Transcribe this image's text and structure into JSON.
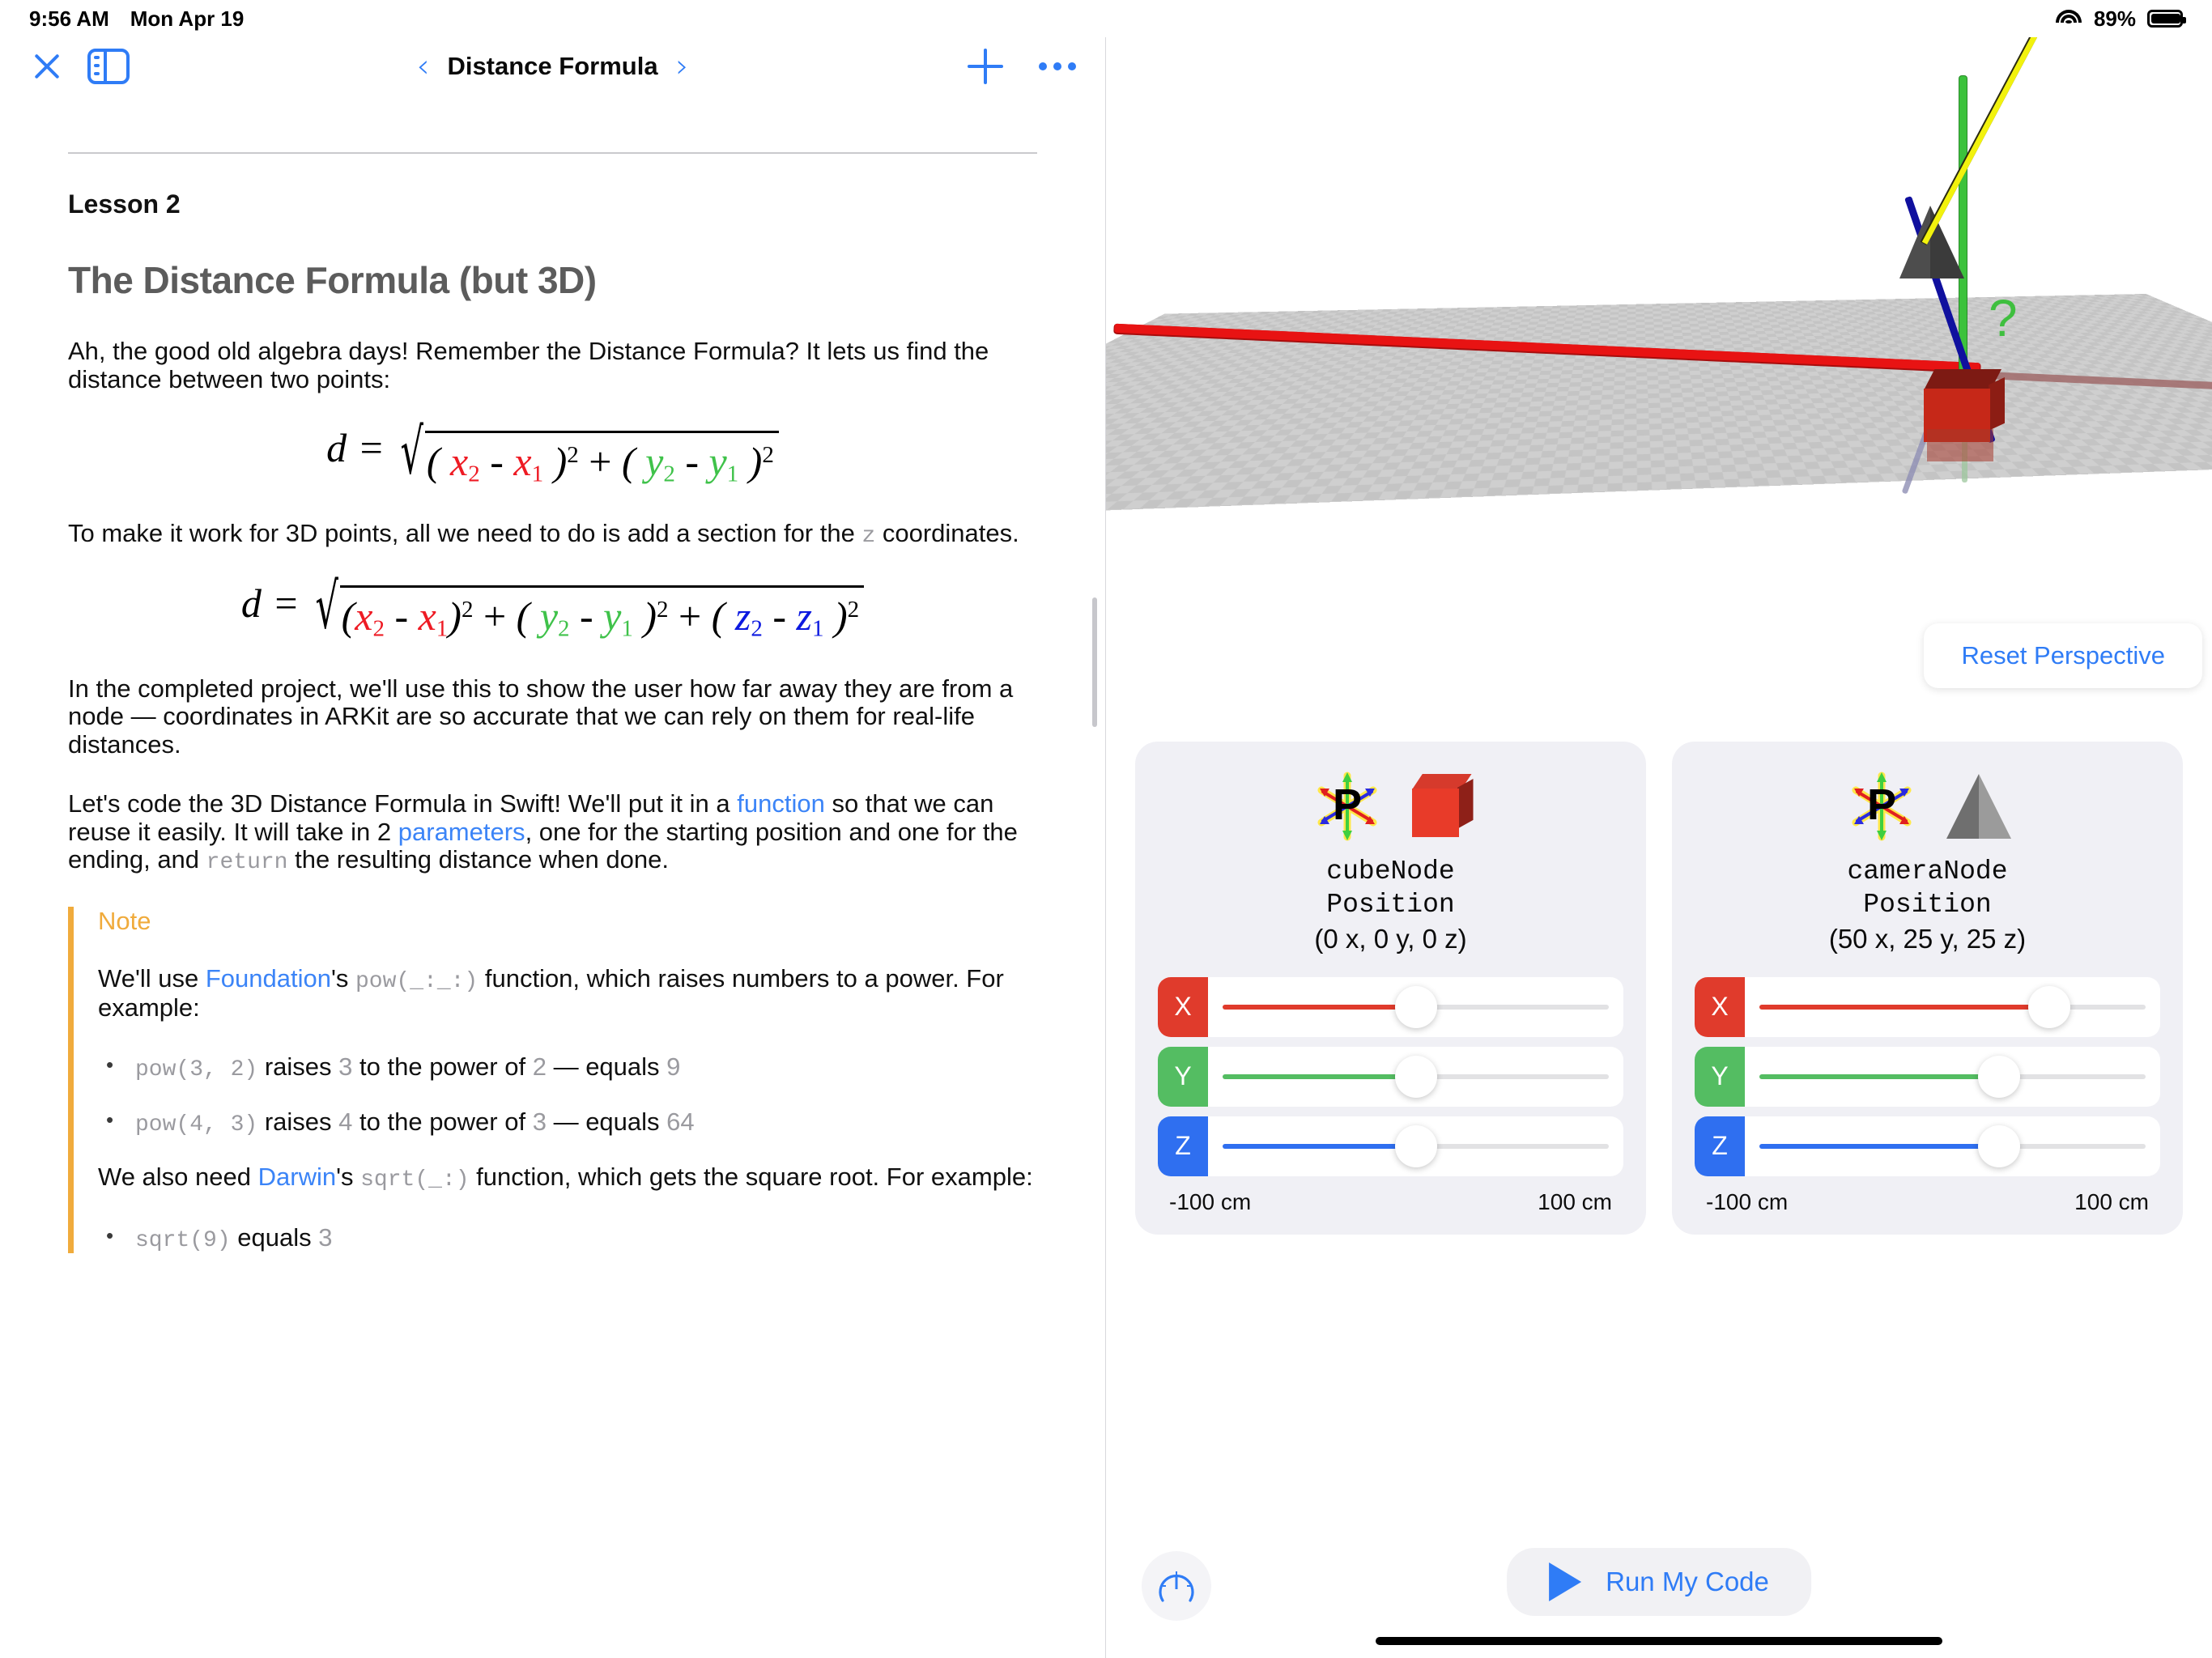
{
  "status_bar": {
    "time": "9:56 AM",
    "date": "Mon Apr 19",
    "battery_percent": "89%",
    "wifi_icon": "wifi-icon",
    "battery_icon": "battery-icon"
  },
  "toolbar": {
    "close_icon": "close-icon",
    "sidebar_icon": "sidebar-toggle-icon",
    "prev_icon": "‹",
    "next_icon": "›",
    "title": "Distance Formula",
    "add_icon": "plus-icon",
    "more_icon": "ellipsis-icon"
  },
  "document": {
    "lesson_label": "Lesson 2",
    "title": "The Distance Formula (but 3D)",
    "p1": "Ah, the good old algebra days! Remember the Distance Formula? It lets us find the distance between two points:",
    "formula_2d": {
      "lhs": "d",
      "eq": "=",
      "radical": "√",
      "terms": "( x₂ - x₁ )² + ( y₂ - y₁ )²"
    },
    "p2_a": "To make it work for 3D points, all we need to do is add a section for the ",
    "p2_code": "z",
    "p2_b": " coordinates.",
    "formula_3d": {
      "lhs": "d",
      "eq": "=",
      "radical": "√",
      "terms": "( x₂ - x₁ )² + ( y₂ - y₁ )² + ( z₂ - z₁ )²"
    },
    "p3": "In the completed project, we'll use this to show the user how far away they are from a node — coordinates in ARKit are so accurate that we can rely on them for real-life distances.",
    "p4_a": "Let's code the 3D Distance Formula in Swift! We'll put it in a ",
    "p4_link1": "function",
    "p4_b": " so that we can reuse it easily. It will take in 2 ",
    "p4_link2": "parameters",
    "p4_c": ", one for the starting position and one for the ending, and ",
    "p4_code": "return",
    "p4_d": " the resulting distance when done.",
    "note": {
      "label": "Note",
      "n1_a": "We'll use ",
      "n1_link": "Foundation",
      "n1_b": "'s ",
      "n1_code": "pow(_:_:)",
      "n1_c": " function, which raises numbers to a power. For example:",
      "bullets_pow": [
        {
          "code": "pow(3, 2)",
          "mid1": " raises ",
          "n1": "3",
          "mid2": " to the power of ",
          "n2": "2",
          "mid3": " — equals ",
          "result": "9"
        },
        {
          "code": "pow(4, 3)",
          "mid1": " raises ",
          "n1": "4",
          "mid2": " to the power of ",
          "n2": "3",
          "mid3": " — equals ",
          "result": "64"
        }
      ],
      "n2_a": "We also need ",
      "n2_link": "Darwin",
      "n2_b": "'s ",
      "n2_code": "sqrt(_:)",
      "n2_c": " function, which gets the square root. For example:",
      "bullets_sqrt": [
        {
          "code": "sqrt(9)",
          "mid": " equals ",
          "result": "3"
        }
      ]
    }
  },
  "scene": {
    "reset_button": "Reset Perspective",
    "question_mark": "?",
    "axis_colors": {
      "x": "#e81313",
      "y": "#3cc23c",
      "z": "#10109e"
    },
    "distance_line_color": "#f2f20d",
    "cube_icon": "cube-3d-object",
    "pyramid_icon": "pyramid-3d-object"
  },
  "cards": [
    {
      "position_icon": "position-axes-icon",
      "object_icon": "red-cube-icon",
      "name": "cubeNode",
      "subtitle": "Position",
      "coords": "(0 x, 0 y, 0 z)",
      "sliders": [
        {
          "axis": "X",
          "color": "#e03b2c",
          "value": 0,
          "percent": 50
        },
        {
          "axis": "Y",
          "color": "#54bd62",
          "value": 0,
          "percent": 50
        },
        {
          "axis": "Z",
          "color": "#2f6ff0",
          "value": 0,
          "percent": 50
        }
      ],
      "range_min": "-100 cm",
      "range_max": "100 cm"
    },
    {
      "position_icon": "position-axes-icon",
      "object_icon": "gray-pyramid-icon",
      "name": "cameraNode",
      "subtitle": "Position",
      "coords": "(50 x, 25 y, 25 z)",
      "sliders": [
        {
          "axis": "X",
          "color": "#e03b2c",
          "value": 50,
          "percent": 75
        },
        {
          "axis": "Y",
          "color": "#54bd62",
          "value": 25,
          "percent": 62
        },
        {
          "axis": "Z",
          "color": "#2f6ff0",
          "value": 25,
          "percent": 62
        }
      ],
      "range_min": "-100 cm",
      "range_max": "100 cm"
    }
  ],
  "bottom_bar": {
    "gauge_icon": "speed-gauge-icon",
    "run_icon": "play-icon",
    "run_label": "Run My Code"
  }
}
